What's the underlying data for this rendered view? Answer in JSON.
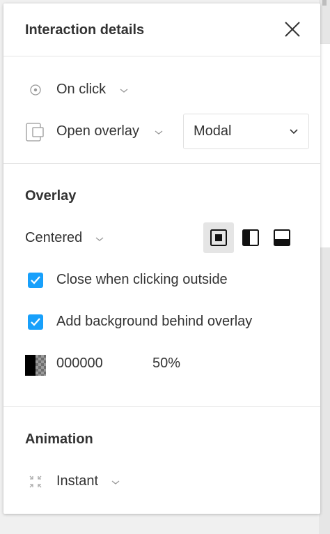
{
  "panel": {
    "title": "Interaction details"
  },
  "trigger": {
    "label": "On click",
    "icon": "trigger-circle-icon"
  },
  "action": {
    "label": "Open overlay",
    "icon": "overlay-frame-icon",
    "destination": "Modal"
  },
  "overlay": {
    "section_title": "Overlay",
    "position": "Centered",
    "position_options": [
      "center-icon",
      "left-icon",
      "bottom-icon"
    ],
    "selected_position": "center-icon",
    "close_outside": {
      "label": "Close when clicking outside",
      "checked": true
    },
    "add_background": {
      "label": "Add background behind overlay",
      "checked": true
    },
    "background_color": {
      "hex": "000000",
      "opacity": "50%"
    }
  },
  "animation": {
    "section_title": "Animation",
    "type": "Instant",
    "icon": "instant-icon"
  },
  "colors": {
    "accent": "#18a0fb",
    "text": "#333333",
    "border": "#e5e5e5"
  }
}
